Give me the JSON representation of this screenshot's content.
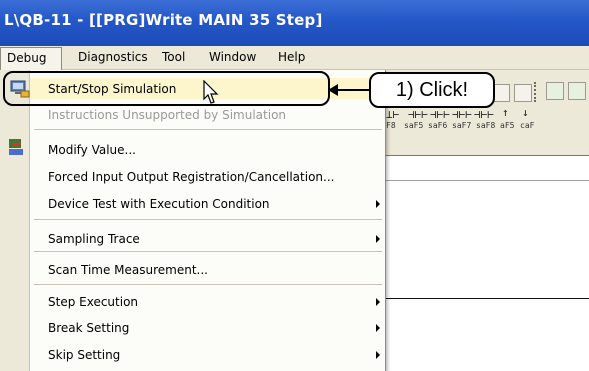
{
  "window": {
    "title": "L\\QB-11 - [[PRG]Write MAIN 35 Step]"
  },
  "menubar": {
    "items": [
      {
        "label": "Debug"
      },
      {
        "label": "Diagnostics"
      },
      {
        "label": "Tool"
      },
      {
        "label": "Window"
      },
      {
        "label": "Help"
      }
    ]
  },
  "debug_menu": {
    "items": [
      {
        "label": "Start/Stop Simulation",
        "icon": "simulation-monitor-icon",
        "submenu": false,
        "enabled": true,
        "highlighted": true
      },
      {
        "label": "Instructions Unsupported by Simulation",
        "submenu": false,
        "enabled": false
      },
      {
        "label": "Modify Value...",
        "icon": "device-modify-icon",
        "submenu": false,
        "enabled": true
      },
      {
        "label": "Forced Input Output Registration/Cancellation...",
        "submenu": false,
        "enabled": true
      },
      {
        "label": "Device Test with Execution Condition",
        "submenu": true,
        "enabled": true
      },
      {
        "label": "Sampling Trace",
        "submenu": true,
        "enabled": true
      },
      {
        "label": "Scan Time Measurement...",
        "submenu": false,
        "enabled": true
      },
      {
        "label": "Step Execution",
        "submenu": true,
        "enabled": true
      },
      {
        "label": "Break Setting",
        "submenu": true,
        "enabled": true
      },
      {
        "label": "Skip Setting",
        "submenu": true,
        "enabled": true
      }
    ]
  },
  "toolbar": {
    "labels": [
      "F8",
      "saF5",
      "saF6",
      "saF7",
      "saF8",
      "aF5",
      "caF"
    ]
  },
  "callout": {
    "text": "1) Click!"
  },
  "colors": {
    "titlebar": "#2457c7",
    "menubar": "#ece9d8",
    "highlight": "#fdf5cc"
  }
}
